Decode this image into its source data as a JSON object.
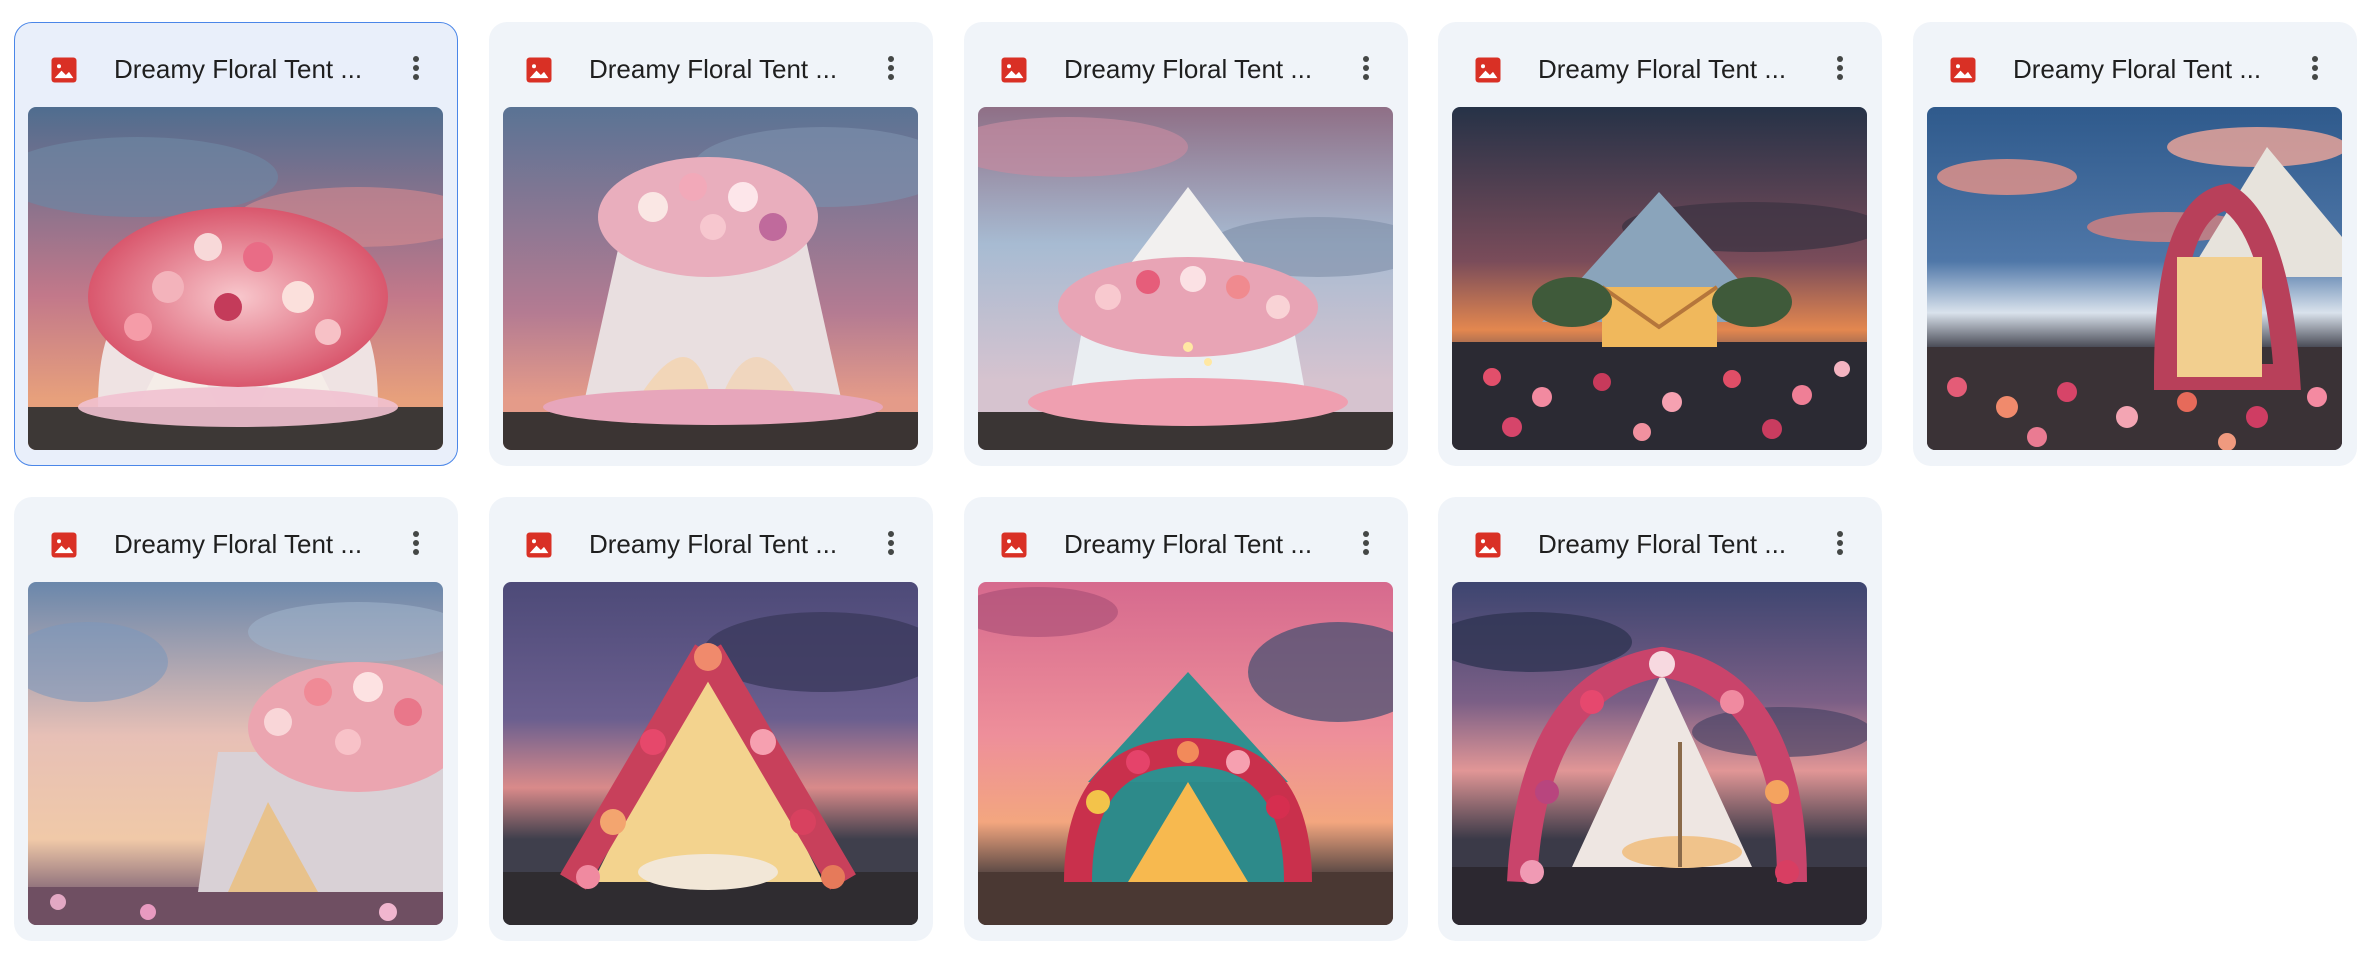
{
  "files": [
    {
      "name": "Dreamy Floral Tent ...",
      "selected": true,
      "file_type": "image-file-icon",
      "thumbnail": "dome-tent-pink-flowers"
    },
    {
      "name": "Dreamy Floral Tent ...",
      "selected": false,
      "file_type": "image-file-icon",
      "thumbnail": "dome-tent-curtains-flowers"
    },
    {
      "name": "Dreamy Floral Tent ...",
      "selected": false,
      "file_type": "image-file-icon",
      "thumbnail": "peaked-tent-flower-dome"
    },
    {
      "name": "Dreamy Floral Tent ...",
      "selected": false,
      "file_type": "image-file-icon",
      "thumbnail": "glowing-tent-flower-field"
    },
    {
      "name": "Dreamy Floral Tent ...",
      "selected": false,
      "file_type": "image-file-icon",
      "thumbnail": "bell-tent-flower-arch"
    },
    {
      "name": "Dreamy Floral Tent ...",
      "selected": false,
      "file_type": "image-file-icon",
      "thumbnail": "canvas-tent-rose-top"
    },
    {
      "name": "Dreamy Floral Tent ...",
      "selected": false,
      "file_type": "image-file-icon",
      "thumbnail": "a-frame-tent-flower-arch"
    },
    {
      "name": "Dreamy Floral Tent ...",
      "selected": false,
      "file_type": "image-file-icon",
      "thumbnail": "teal-tent-flower-arch"
    },
    {
      "name": "Dreamy Floral Tent ...",
      "selected": false,
      "file_type": "image-file-icon",
      "thumbnail": "flower-arch-tent-mountains"
    }
  ],
  "colors": {
    "card_background": "#f0f4f9",
    "selected_background": "#e9effa",
    "selected_border": "#4a86e8",
    "image_icon": "#d93025",
    "text": "#1f1f1f",
    "more_icon": "#444746"
  }
}
